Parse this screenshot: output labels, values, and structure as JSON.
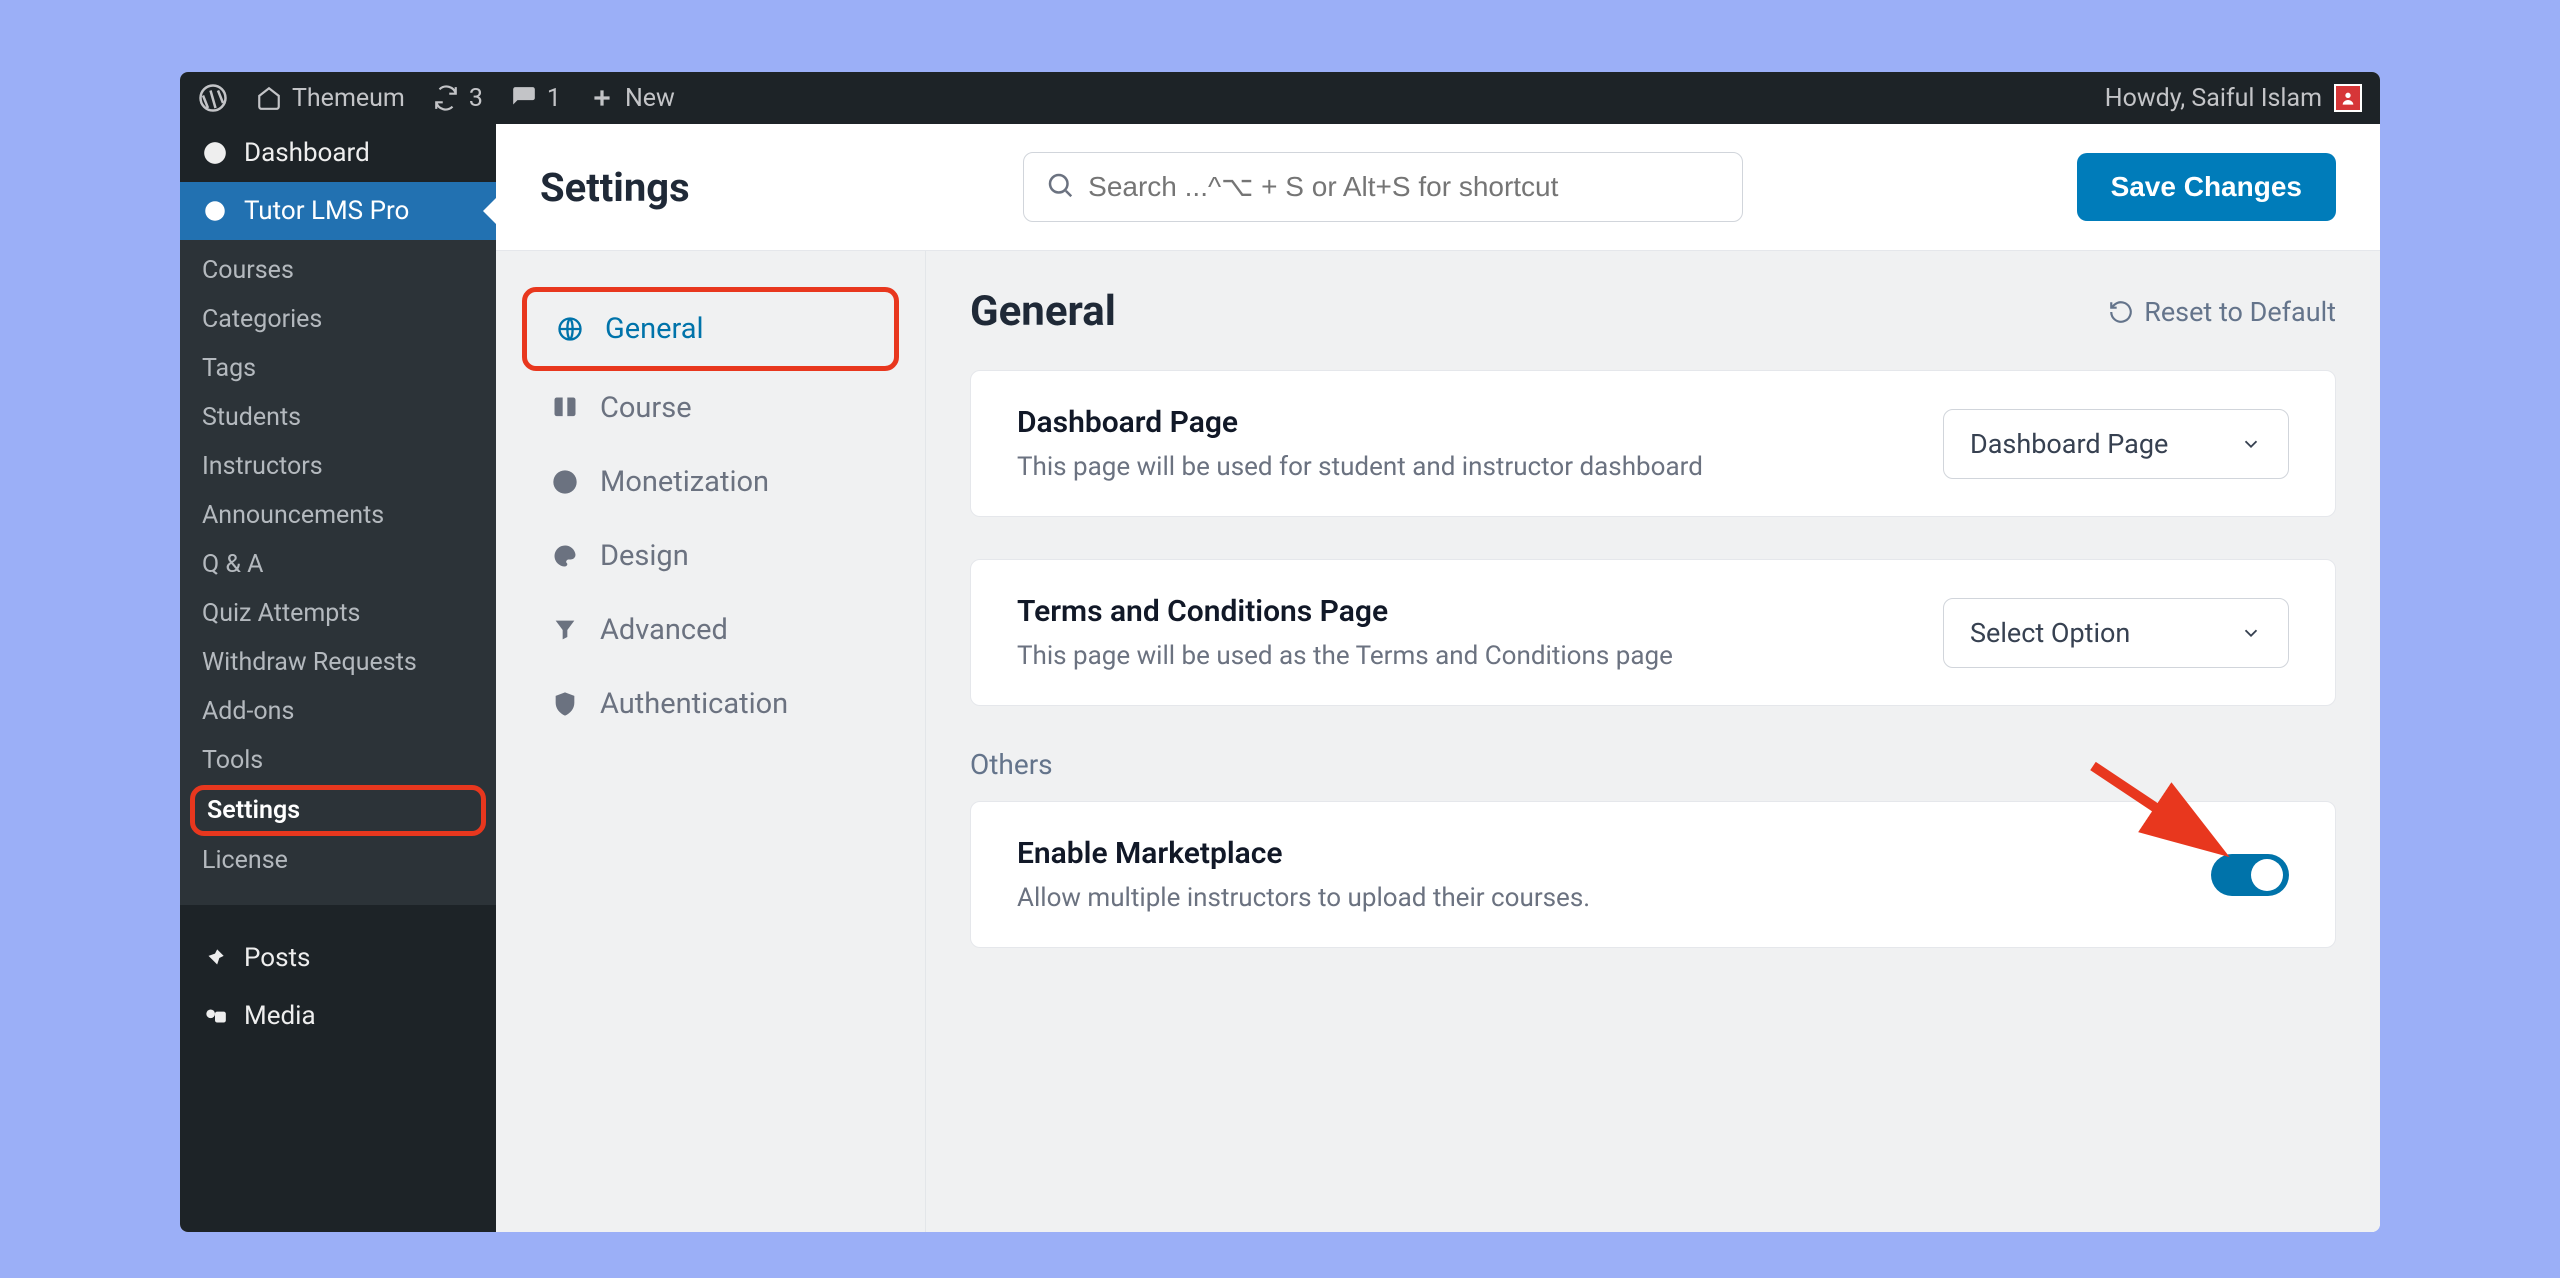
{
  "adminBar": {
    "site": "Themeum",
    "updates": "3",
    "comments": "1",
    "new": "New",
    "greeting": "Howdy, Saiful Islam"
  },
  "sidebar": {
    "dashboard": "Dashboard",
    "activePlugin": "Tutor LMS Pro",
    "sub": {
      "courses": "Courses",
      "categories": "Categories",
      "tags": "Tags",
      "students": "Students",
      "instructors": "Instructors",
      "announcements": "Announcements",
      "qa": "Q & A",
      "quiz": "Quiz Attempts",
      "withdraw": "Withdraw Requests",
      "addons": "Add-ons",
      "tools": "Tools",
      "settings": "Settings",
      "license": "License"
    },
    "posts": "Posts",
    "media": "Media"
  },
  "header": {
    "title": "Settings",
    "searchPlaceholder": "Search ...^⌥ + S or Alt+S for shortcut",
    "save": "Save Changes"
  },
  "tabs": {
    "general": "General",
    "course": "Course",
    "monetization": "Monetization",
    "design": "Design",
    "advanced": "Advanced",
    "authentication": "Authentication"
  },
  "panel": {
    "title": "General",
    "reset": "Reset to Default",
    "dashboardPage": {
      "label": "Dashboard Page",
      "help": "This page will be used for student and instructor dashboard",
      "selected": "Dashboard Page"
    },
    "terms": {
      "label": "Terms and Conditions Page",
      "help": "This page will be used as the Terms and Conditions page",
      "selected": "Select Option"
    },
    "others": "Others",
    "marketplace": {
      "label": "Enable Marketplace",
      "help": "Allow multiple instructors to upload their courses."
    }
  }
}
